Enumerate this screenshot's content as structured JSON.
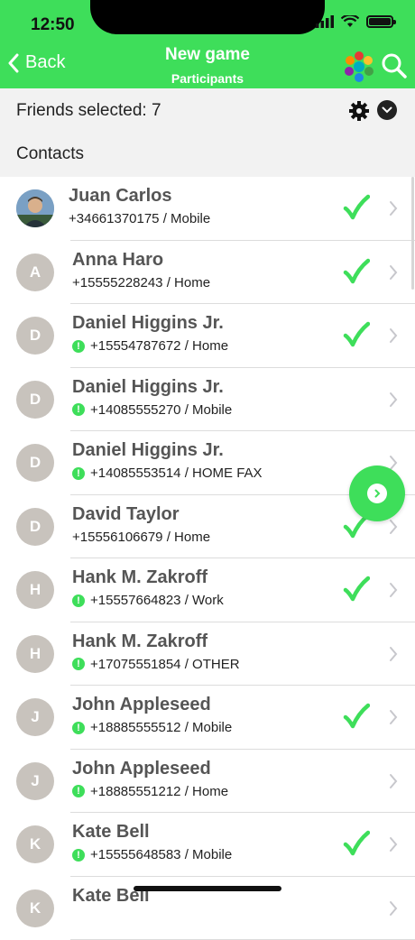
{
  "status": {
    "time": "12:50"
  },
  "nav": {
    "back_label": "Back",
    "title": "New game",
    "subtitle": "Participants"
  },
  "friends_bar": {
    "text": "Friends selected: 7"
  },
  "section": {
    "contacts": "Contacts"
  },
  "colors": {
    "accent": "#3ede5a",
    "avatar_bg": "#c8c3bd",
    "header_bg": "#f2f2f2"
  },
  "contacts": [
    {
      "initial": "",
      "name": "Juan Carlos",
      "detail": "+34661370175 / Mobile",
      "badge": false,
      "selected": true,
      "photo": true
    },
    {
      "initial": "A",
      "name": "Anna Haro",
      "detail": "+15555228243 / Home",
      "badge": false,
      "selected": true
    },
    {
      "initial": "D",
      "name": "Daniel Higgins Jr.",
      "detail": "+15554787672 / Home",
      "badge": true,
      "selected": true
    },
    {
      "initial": "D",
      "name": "Daniel Higgins Jr.",
      "detail": "+14085555270 / Mobile",
      "badge": true,
      "selected": false
    },
    {
      "initial": "D",
      "name": "Daniel Higgins Jr.",
      "detail": "+14085553514 / HOME FAX",
      "badge": true,
      "selected": false
    },
    {
      "initial": "D",
      "name": "David Taylor",
      "detail": "+15556106679 / Home",
      "badge": false,
      "selected": true
    },
    {
      "initial": "H",
      "name": "Hank M. Zakroff",
      "detail": "+15557664823 / Work",
      "badge": true,
      "selected": true
    },
    {
      "initial": "H",
      "name": "Hank M. Zakroff",
      "detail": "+17075551854 / OTHER",
      "badge": true,
      "selected": false
    },
    {
      "initial": "J",
      "name": "John Appleseed",
      "detail": "+18885555512 / Mobile",
      "badge": true,
      "selected": true
    },
    {
      "initial": "J",
      "name": "John Appleseed",
      "detail": "+18885551212 / Home",
      "badge": true,
      "selected": false
    },
    {
      "initial": "K",
      "name": "Kate Bell",
      "detail": "+15555648583 / Mobile",
      "badge": true,
      "selected": true
    },
    {
      "initial": "K",
      "name": "Kate Bell",
      "detail": "",
      "badge": false,
      "selected": false
    }
  ]
}
